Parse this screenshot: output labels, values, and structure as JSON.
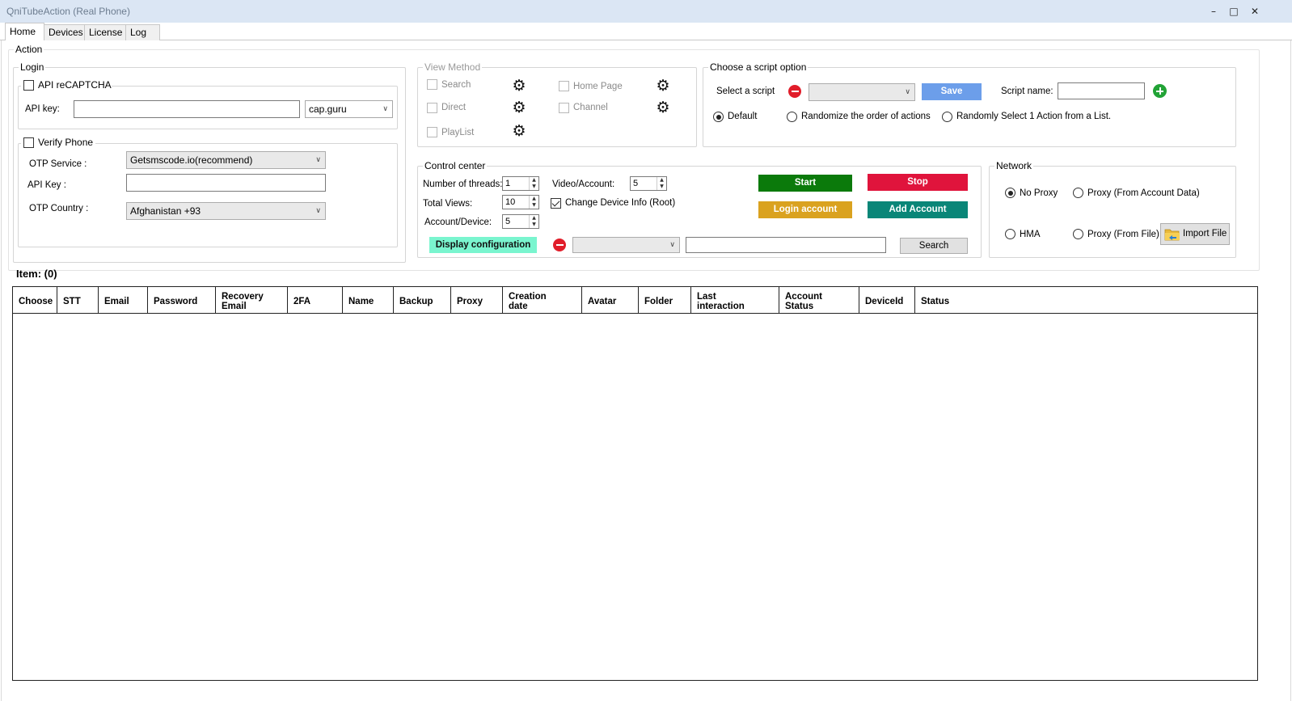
{
  "window": {
    "title": "QniTubeAction (Real Phone)",
    "minimize": "–",
    "maximize": "□",
    "close": "✕"
  },
  "tabs": [
    "Home",
    "Devices",
    "License",
    "Log"
  ],
  "action": {
    "label": "Action",
    "login": {
      "label": "Login",
      "recaptcha": {
        "label": "API reCAPTCHA",
        "checked": false,
        "api_key_label": "API key:",
        "api_key_value": "",
        "provider": "cap.guru"
      },
      "verify_phone": {
        "label": "Verify Phone",
        "checked": false,
        "otp_service_label": "OTP Service :",
        "otp_service_value": "Getsmscode.io(recommend)",
        "api_key_label": "API Key :",
        "api_key_value": "",
        "otp_country_label": "OTP Country :",
        "otp_country_value": "Afghanistan +93"
      }
    },
    "view_method": {
      "label": "View Method",
      "items": [
        {
          "label": "Search",
          "icon": "gear-icon"
        },
        {
          "label": "Direct",
          "icon": "gear-icon"
        },
        {
          "label": "PlayList",
          "icon": "gear-icon"
        },
        {
          "label": "Home Page",
          "icon": "gear-icon"
        },
        {
          "label": "Channel",
          "icon": "gear-icon"
        }
      ]
    },
    "script_option": {
      "label": "Choose a script option",
      "select_label": "Select a script",
      "selected_script": "",
      "save_label": "Save",
      "script_name_label": "Script name:",
      "script_name_value": "",
      "modes": [
        {
          "label": "Default",
          "selected": true
        },
        {
          "label": "Randomize the order of actions",
          "selected": false
        },
        {
          "label": "Randomly Select 1 Action from a List.",
          "selected": false
        }
      ]
    },
    "control_center": {
      "label": "Control center",
      "threads_label": "Number of threads:",
      "threads_value": "1",
      "total_views_label": "Total Views:",
      "total_views_value": "10",
      "account_device_label": "Account/Device:",
      "account_device_value": "5",
      "video_account_label": "Video/Account:",
      "video_account_value": "5",
      "change_device_label": "Change Device Info (Root)",
      "change_device_checked": true,
      "start_label": "Start",
      "stop_label": "Stop",
      "login_account_label": "Login account",
      "add_account_label": "Add Account",
      "display_config_label": "Display configuration",
      "filter_value": "",
      "search_value": "",
      "search_label": "Search"
    },
    "network": {
      "label": "Network",
      "options": [
        {
          "label": "No Proxy",
          "selected": true
        },
        {
          "label": "Proxy (From Account Data)",
          "selected": false
        },
        {
          "label": "HMA",
          "selected": false
        },
        {
          "label": "Proxy (From File)",
          "selected": false
        }
      ],
      "import_label": "Import File"
    }
  },
  "items_count_label": "Item: (0)",
  "table": {
    "columns": [
      "Choose",
      "STT",
      "Email",
      "Password",
      "Recovery Email",
      "2FA",
      "Name",
      "Backup",
      "Proxy",
      "Creation date",
      "Avatar",
      "Folder",
      "Last interaction",
      "Account Status",
      "DeviceId",
      "Status"
    ],
    "rows": []
  },
  "colors": {
    "start": "#0b7a0b",
    "stop": "#e0143c",
    "login": "#daa21f",
    "add": "#0a8678",
    "save": "#6c9eea",
    "display": "#7af5cf",
    "titlebar": "#dbe6f4"
  }
}
